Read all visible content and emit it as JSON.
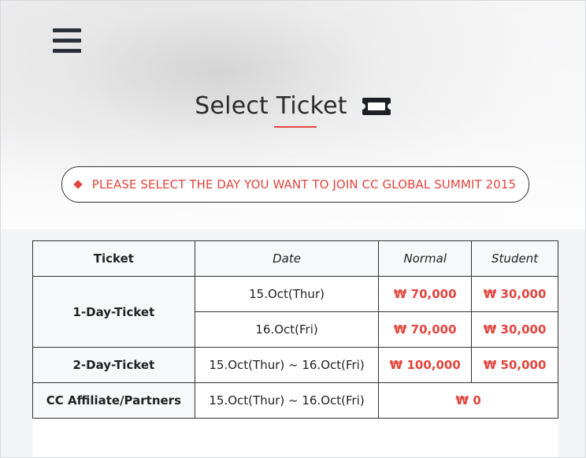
{
  "page": {
    "title": "Select Ticket",
    "notice": "PLEASE SELECT THE DAY YOU WANT TO JOIN CC GLOBAL SUMMIT 2015",
    "accent": "#e2453d"
  },
  "table": {
    "headers": [
      "Ticket",
      "Date",
      "Normal",
      "Student"
    ],
    "rows": [
      {
        "ticket": "1-Day-Ticket",
        "date": "15.Oct(Thur)",
        "normal": "₩ 70,000",
        "student": "₩ 30,000"
      },
      {
        "ticket": "1-Day-Ticket",
        "date": "16.Oct(Fri)",
        "normal": "₩ 70,000",
        "student": "₩ 30,000"
      },
      {
        "ticket": "2-Day-Ticket",
        "date": "15.Oct(Thur) ~ 16.Oct(Fri)",
        "normal": "₩ 100,000",
        "student": "₩ 50,000"
      },
      {
        "ticket": "CC Affiliate/Partners",
        "date": "15.Oct(Thur) ~ 16.Oct(Fri)",
        "combined": "₩ 0"
      }
    ]
  }
}
